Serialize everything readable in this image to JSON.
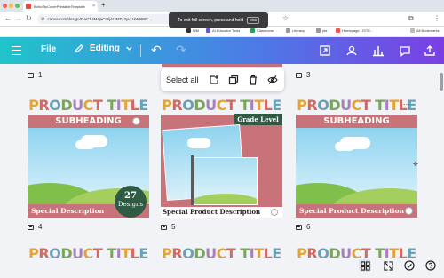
{
  "browser": {
    "tab_title": "BohoStyCoverPrintableTemplate",
    "url": "canva.com/design/DAGbJM4jeCU/jAI3MTx2yv1HW988C...",
    "fullscreen_notice": "To exit full screen, press and hold",
    "fullscreen_key": "esc",
    "bookmarks": [
      "WM",
      "AI Educator Tools",
      "Classroom",
      "Literacy",
      "ytd",
      "Homepage - ISTE...",
      "All Bookmarks"
    ]
  },
  "header": {
    "file_label": "File",
    "editing_label": "Editing",
    "gradient_start": "#20c4cb",
    "gradient_end": "#7a3fe4"
  },
  "toolbar": {
    "select_all_label": "Select all"
  },
  "pages": [
    {
      "number": "1"
    },
    {
      "number": "3"
    },
    {
      "number": "4"
    },
    {
      "number": "5"
    },
    {
      "number": "6"
    }
  ],
  "cards": {
    "left": {
      "title": "PRODUCT TITLE",
      "subheading": "SUBHEADING",
      "description": "Special Description",
      "badge_number": "27",
      "badge_word": "Designs"
    },
    "middle": {
      "title": "PRODUCT TITLE",
      "grade_label": "Grade Level",
      "description": "Special Product Description"
    },
    "right": {
      "title": "PRODUCT TITLE",
      "subheading": "SUBHEADING",
      "description": "Special Product Description"
    }
  },
  "bottom_row_title": "PRODUCT TITLE"
}
